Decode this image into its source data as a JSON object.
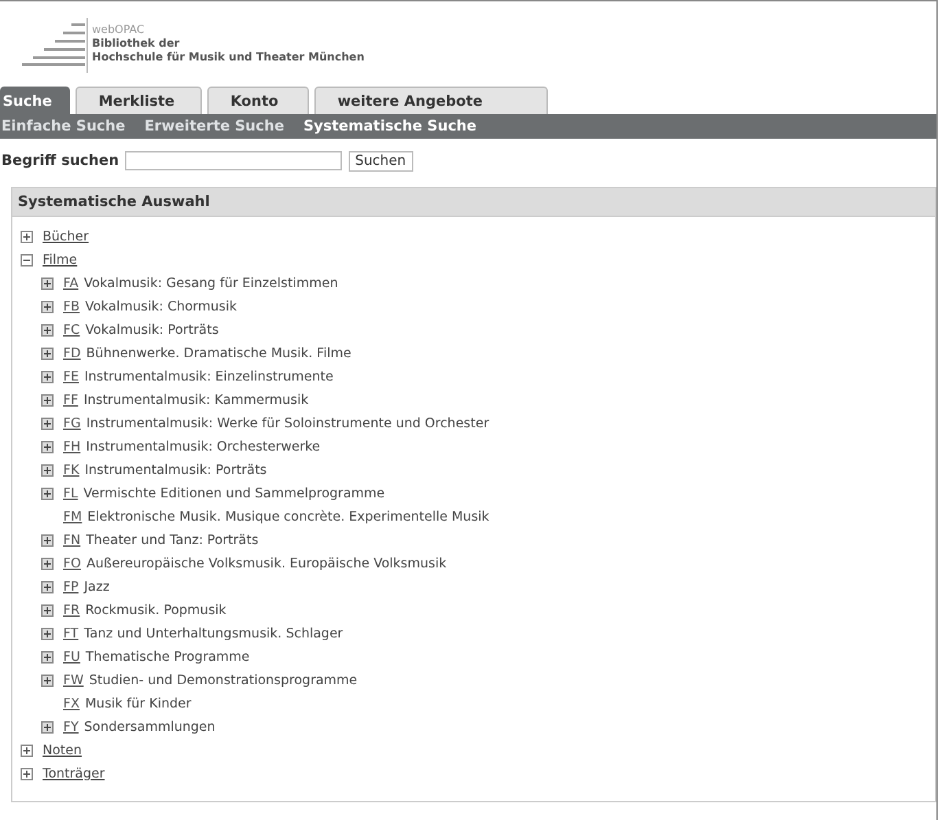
{
  "header": {
    "product": "webOPAC",
    "library_line1": "Bibliothek der",
    "library_line2": "Hochschule für Musik und Theater München"
  },
  "tabs": [
    {
      "label": "Suche",
      "selected": true
    },
    {
      "label": "Merkliste",
      "selected": false
    },
    {
      "label": "Konto",
      "selected": false
    },
    {
      "label": "weitere Angebote",
      "selected": false
    }
  ],
  "subnav": [
    {
      "label": "Einfache Suche",
      "selected": false
    },
    {
      "label": "Erweiterte Suche",
      "selected": false
    },
    {
      "label": "Systematische Suche",
      "selected": true
    }
  ],
  "search": {
    "label": "Begriff suchen",
    "button": "Suchen"
  },
  "panel": {
    "title": "Systematische Auswahl",
    "tree": [
      {
        "label": "Bücher",
        "expanded": false
      },
      {
        "label": "Filme",
        "expanded": true,
        "children": [
          {
            "kind": "node",
            "code": "FA",
            "label": "Vokalmusik: Gesang für Einzelstimmen"
          },
          {
            "kind": "node",
            "code": "FB",
            "label": "Vokalmusik: Chormusik"
          },
          {
            "kind": "node",
            "code": "FC",
            "label": "Vokalmusik: Porträts"
          },
          {
            "kind": "node",
            "code": "FD",
            "label": "Bühnenwerke. Dramatische Musik. Filme"
          },
          {
            "kind": "node",
            "code": "FE",
            "label": "Instrumentalmusik: Einzelinstrumente"
          },
          {
            "kind": "node",
            "code": "FF",
            "label": "Instrumentalmusik: Kammermusik"
          },
          {
            "kind": "node",
            "code": "FG",
            "label": "Instrumentalmusik: Werke für Soloinstrumente und Orchester"
          },
          {
            "kind": "node",
            "code": "FH",
            "label": "Instrumentalmusik: Orchesterwerke"
          },
          {
            "kind": "node",
            "code": "FK",
            "label": "Instrumentalmusik: Porträts"
          },
          {
            "kind": "node",
            "code": "FL",
            "label": "Vermischte Editionen und Sammelprogramme"
          },
          {
            "kind": "leaf",
            "code": "FM",
            "label": "Elektronische Musik. Musique concrète. Experimentelle Musik"
          },
          {
            "kind": "node",
            "code": "FN",
            "label": "Theater und Tanz: Porträts"
          },
          {
            "kind": "node",
            "code": "FO",
            "label": "Außereuropäische Volksmusik. Europäische Volksmusik"
          },
          {
            "kind": "node",
            "code": "FP",
            "label": "Jazz"
          },
          {
            "kind": "node",
            "code": "FR",
            "label": "Rockmusik. Popmusik"
          },
          {
            "kind": "node",
            "code": "FT",
            "label": "Tanz und Unterhaltungsmusik. Schlager"
          },
          {
            "kind": "node",
            "code": "FU",
            "label": "Thematische Programme"
          },
          {
            "kind": "node",
            "code": "FW",
            "label": "Studien- und Demonstrationsprogramme"
          },
          {
            "kind": "leaf",
            "code": "FX",
            "label": "Musik für Kinder"
          },
          {
            "kind": "node",
            "code": "FY",
            "label": "Sondersammlungen"
          }
        ]
      },
      {
        "label": "Noten",
        "expanded": false
      },
      {
        "label": "Tonträger",
        "expanded": false
      }
    ]
  }
}
